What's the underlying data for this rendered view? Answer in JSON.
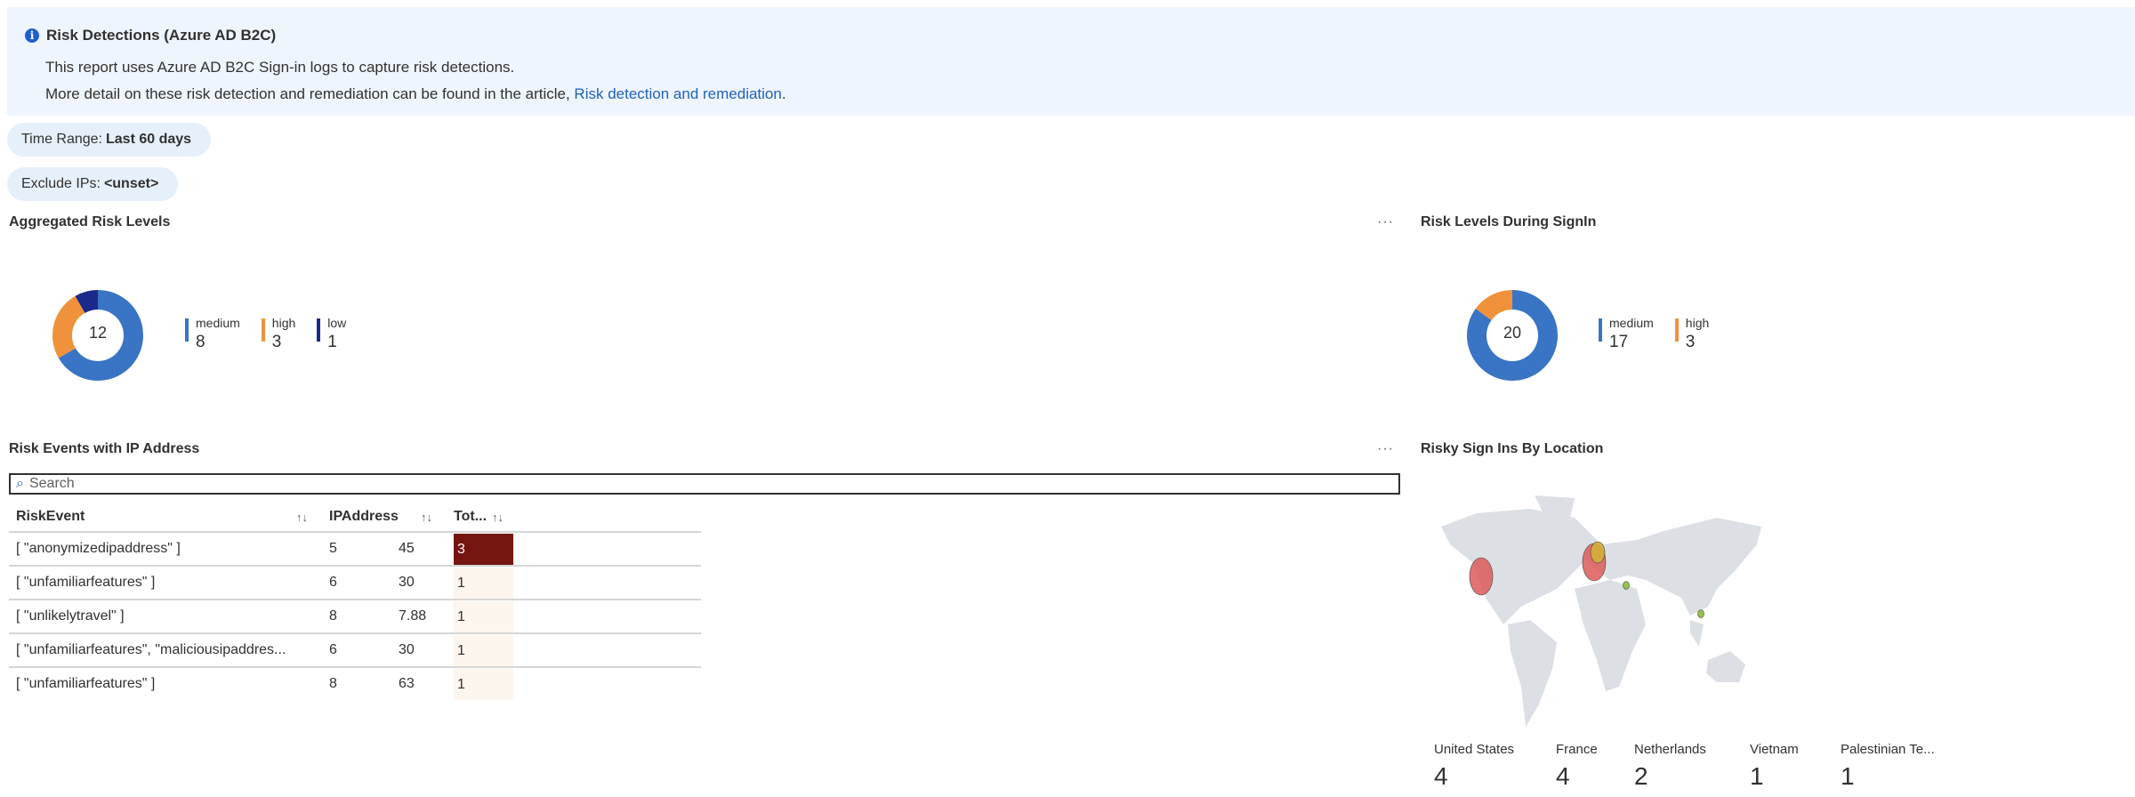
{
  "banner": {
    "title": "Risk Detections (Azure AD B2C)",
    "line1": "This report uses Azure AD B2C Sign-in logs to capture risk detections.",
    "line2": "More detail on these risk detection and remediation can be found in the article, ",
    "link": "Risk detection and remediation",
    "period": ".",
    "icon": "info-icon"
  },
  "params": {
    "time_label": "Time Range:",
    "time_value": "Last 60 days",
    "exclude_label": "Exclude IPs:",
    "exclude_value": "<unset>"
  },
  "aggregated": {
    "title": "Aggregated Risk Levels",
    "more": "···",
    "total": "12",
    "items": [
      {
        "label": "medium",
        "value": 8,
        "color": "#3a74c4"
      },
      {
        "label": "high",
        "value": 3,
        "color": "#f0923b"
      },
      {
        "label": "low",
        "value": 1,
        "color": "#1b2a8a"
      }
    ]
  },
  "signin": {
    "title": "Risk Levels During SignIn",
    "total": "20",
    "items": [
      {
        "label": "medium",
        "value": 17,
        "color": "#3a74c4"
      },
      {
        "label": "high",
        "value": 3,
        "color": "#f0923b"
      }
    ]
  },
  "events": {
    "title": "Risk Events with IP Address",
    "more": "···",
    "search_placeholder": "Search",
    "columns": [
      "RiskEvent",
      "IPAddress",
      "Tot..."
    ],
    "sort_glyph": "↑↓",
    "rows": [
      {
        "event": "[ \"anonymizedipaddress\" ]",
        "ip_start": "5",
        "ip_end": "45",
        "total": "3"
      },
      {
        "event": "[ \"unfamiliarfeatures\" ]",
        "ip_start": "6",
        "ip_end": "30",
        "total": "1"
      },
      {
        "event": "[ \"unlikelytravel\" ]",
        "ip_start": "8",
        "ip_end": "7.88",
        "total": "1"
      },
      {
        "event": "[ \"unfamiliarfeatures\", \"maliciousipaddres...",
        "ip_start": "6",
        "ip_end": "30",
        "total": "1"
      },
      {
        "event": "[ \"unfamiliarfeatures\" ]",
        "ip_start": "8",
        "ip_end": "63",
        "total": "1"
      }
    ],
    "heat_max_color": "#74150f",
    "heat_min_color": "#fdf6ee"
  },
  "map": {
    "title": "Risky Sign Ins By Location",
    "locations": [
      {
        "name": "United States",
        "value": "4"
      },
      {
        "name": "France",
        "value": "4"
      },
      {
        "name": "Netherlands",
        "value": "2"
      },
      {
        "name": "Vietnam",
        "value": "1"
      },
      {
        "name": "Palestinian Te...",
        "value": "1"
      }
    ]
  }
}
